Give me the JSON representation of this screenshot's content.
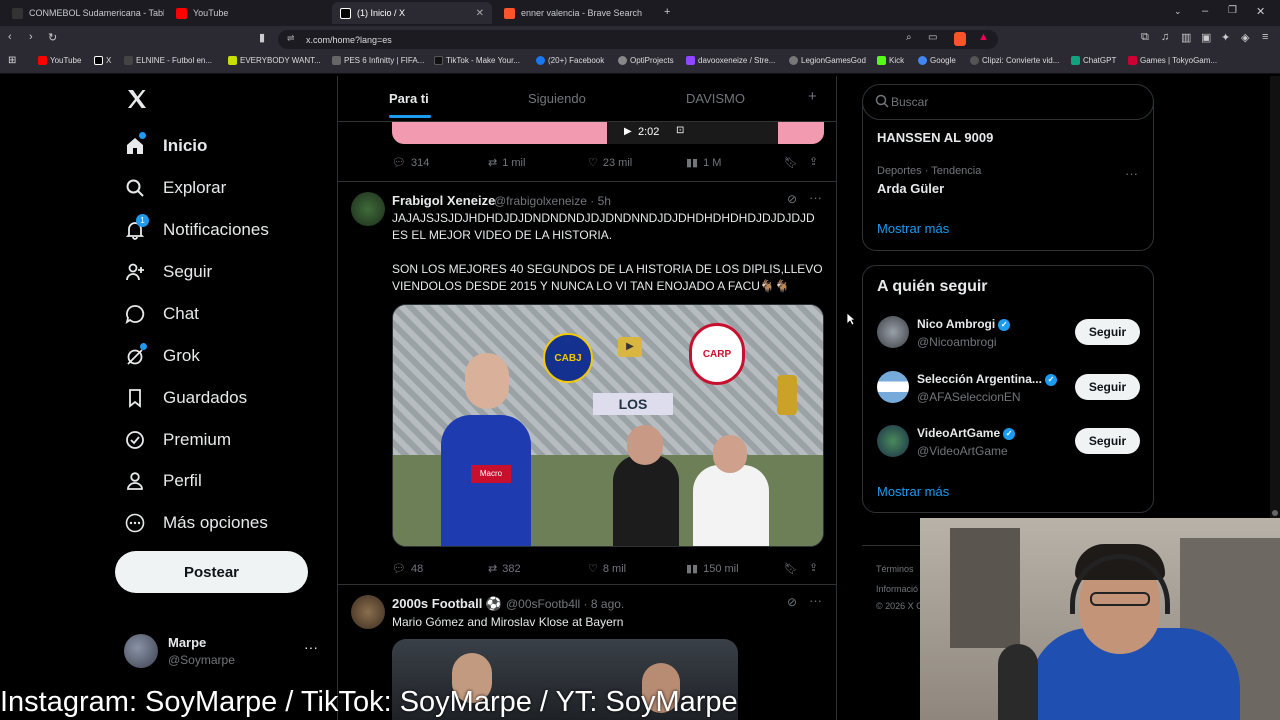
{
  "browser": {
    "tabs": [
      {
        "label": "CONMEBOL Sudamericana - Tabla, fi",
        "color": "#1a1a1a"
      },
      {
        "label": "YouTube",
        "color": "#ff0000"
      },
      {
        "label": "(1) Inicio / X",
        "color": "#000000"
      },
      {
        "label": "enner valencia - Brave Search",
        "color": "#fb542b"
      }
    ],
    "new_tab": "+",
    "url": "x.com/home?lang=es",
    "bookmarks": [
      {
        "label": "YouTube",
        "color": "#ff0000"
      },
      {
        "label": "X",
        "color": "#000000"
      },
      {
        "label": "ELNINE - Futbol en...",
        "color": "#333333"
      },
      {
        "label": "EVERYBODY WANT...",
        "color": "#c8e000"
      },
      {
        "label": "PES 6 Infinitty | FIFA...",
        "color": "#666666"
      },
      {
        "label": "TikTok - Make Your...",
        "color": "#111111"
      },
      {
        "label": "(20+) Facebook",
        "color": "#1877f2"
      },
      {
        "label": "OptiProjects",
        "color": "#888888"
      },
      {
        "label": "davooxeneize / Stre...",
        "color": "#9146ff"
      },
      {
        "label": "LegionGamesGod",
        "color": "#777777"
      },
      {
        "label": "Kick",
        "color": "#53fc18"
      },
      {
        "label": "Google",
        "color": "#4285f4"
      },
      {
        "label": "Clipzi: Convierte vid...",
        "color": "#555555"
      },
      {
        "label": "ChatGPT",
        "color": "#10a37f"
      },
      {
        "label": "Games | TokyoGam...",
        "color": "#cc0033"
      }
    ]
  },
  "sidebar": {
    "items": [
      {
        "label": "Inicio",
        "icon": "home-icon"
      },
      {
        "label": "Explorar",
        "icon": "search-icon"
      },
      {
        "label": "Notificaciones",
        "icon": "bell-icon",
        "badge": "1"
      },
      {
        "label": "Seguir",
        "icon": "add-user-icon"
      },
      {
        "label": "Chat",
        "icon": "chat-icon"
      },
      {
        "label": "Grok",
        "icon": "grok-icon"
      },
      {
        "label": "Guardados",
        "icon": "bookmark-icon"
      },
      {
        "label": "Premium",
        "icon": "premium-icon"
      },
      {
        "label": "Perfil",
        "icon": "person-icon"
      },
      {
        "label": "Más opciones",
        "icon": "more-icon"
      }
    ],
    "post_button": "Postear",
    "account": {
      "name": "Marpe",
      "handle": "@Soymarpe",
      "menu": "···"
    }
  },
  "feed": {
    "tabs": [
      "Para ti",
      "Siguiendo",
      "DAVISMO"
    ],
    "add_tab": "+",
    "top_video_time": "2:02",
    "top_metrics": {
      "replies": "314",
      "reposts": "1 mil",
      "likes": "23 mil",
      "views": "1 M"
    },
    "tweet1": {
      "name": "Frabigol Xeneize",
      "handle": "@frabigolxeneize · 5h",
      "line1": "JAJAJSJSJDJHDHDJDJDNDNDNDJDJDNDNNDJDJDHDHDHDHDJDJDJDJD",
      "line2": "ES EL MEJOR VIDEO DE LA HISTORIA.",
      "line3": "SON LOS MEJORES 40 SEGUNDOS DE LA HISTORIA DE LOS DIPLIS,LLEVO",
      "line4": "VIENDOLOS DESDE 2015 Y NUNCA LO VI TAN ENOJADO A FACU🐐🐐",
      "media_sign": "LOS",
      "media_crest_left": "CABJ",
      "media_crest_right": "CARP",
      "media_shirt": "Macro",
      "metrics": {
        "replies": "48",
        "reposts": "382",
        "likes": "8 mil",
        "views": "150 mil"
      }
    },
    "tweet2": {
      "name": "2000s Football ⚽",
      "handle": "@00sFootb4ll · 8 ago.",
      "text": "Mario Gómez and Miroslav Klose at Bayern"
    }
  },
  "right": {
    "search_placeholder": "Buscar",
    "trend_top": "HANSSEN AL 9009",
    "trend_category": "Deportes · Tendencia",
    "trend_name": "Arda Güler",
    "show_more_1": "Mostrar más",
    "who_to_follow_title": "A quién seguir",
    "follow_label": "Seguir",
    "accounts": [
      {
        "name": "Nico Ambrogi",
        "handle": "@Nicoambrogi"
      },
      {
        "name": "Selección Argentina...",
        "handle": "@AFASeleccionEN"
      },
      {
        "name": "VideoArtGame",
        "handle": "@VideoArtGame"
      }
    ],
    "show_more_2": "Mostrar más",
    "footer_1": "Términos",
    "footer_2": "Informació",
    "footer_3": "© 2026 X C"
  },
  "overlay": {
    "caption": "Instagram: SoyMarpe /  TikTok: SoyMarpe / YT: SoyMarpe"
  },
  "colors": {
    "accent": "#1d9bf0",
    "background": "#000000",
    "border": "#2f3336",
    "muted": "#71767b"
  }
}
